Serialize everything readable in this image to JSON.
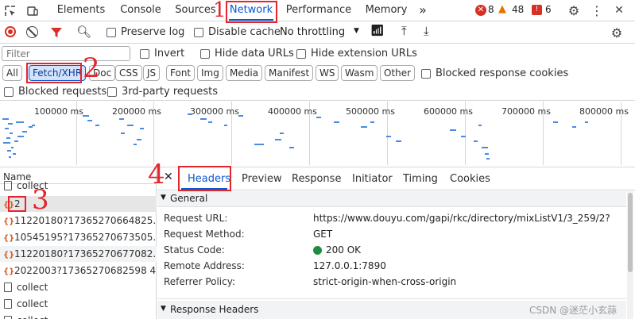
{
  "toolbar": {
    "tabs": [
      "Elements",
      "Console",
      "Sources",
      "Network",
      "Performance",
      "Memory"
    ],
    "more": "»",
    "errors": "8",
    "warnings": "48",
    "issues": "6"
  },
  "controls": {
    "preserve_log": "Preserve log",
    "disable_cache": "Disable cache",
    "throttling": "No throttling"
  },
  "filter": {
    "placeholder": "Filter",
    "invert": "Invert",
    "hide_data_urls": "Hide data URLs",
    "hide_extension_urls": "Hide extension URLs"
  },
  "types": [
    "All",
    "Fetch/XHR",
    "Doc",
    "CSS",
    "JS",
    "Font",
    "Img",
    "Media",
    "Manifest",
    "WS",
    "Wasm",
    "Other"
  ],
  "blocked_response_cookies": "Blocked response cookies",
  "blocked_requests": "Blocked requests",
  "third_party": "3rd-party requests",
  "timeline": {
    "ticks": [
      "100000 ms",
      "200000 ms",
      "300000 ms",
      "400000 ms",
      "500000 ms",
      "600000 ms",
      "700000 ms",
      "800000 ms"
    ]
  },
  "requests": {
    "header": "Name",
    "items": [
      {
        "name": "collect",
        "kind": "doc"
      },
      {
        "name": "2",
        "kind": "xhr"
      },
      {
        "name": "11220180?17365270664825...",
        "kind": "xhr"
      },
      {
        "name": "10545195?17365270673505...",
        "kind": "xhr"
      },
      {
        "name": "11220180?17365270677082...",
        "kind": "xhr"
      },
      {
        "name": "2022003?17365270682598 4...",
        "kind": "xhr"
      },
      {
        "name": "collect",
        "kind": "doc"
      },
      {
        "name": "collect",
        "kind": "doc"
      },
      {
        "name": "collect",
        "kind": "doc"
      }
    ]
  },
  "detail": {
    "tabs": [
      "Headers",
      "Preview",
      "Response",
      "Initiator",
      "Timing",
      "Cookies"
    ],
    "general_title": "General",
    "fields": [
      {
        "label": "Request URL:",
        "value": "https://www.douyu.com/gapi/rkc/directory/mixListV1/3_259/2?"
      },
      {
        "label": "Request Method:",
        "value": "GET"
      },
      {
        "label": "Status Code:",
        "value": "200 OK"
      },
      {
        "label": "Remote Address:",
        "value": "127.0.0.1:7890"
      },
      {
        "label": "Referrer Policy:",
        "value": "strict-origin-when-cross-origin"
      }
    ],
    "response_headers_title": "Response Headers"
  },
  "annotations": [
    "1",
    "2",
    "3",
    "4"
  ],
  "watermark": "CSDN @迷茫小玄蒜",
  "colors": {
    "accent": "#0b57d0",
    "annotation": "#e3262c",
    "status_ok": "#1e8e3e"
  }
}
